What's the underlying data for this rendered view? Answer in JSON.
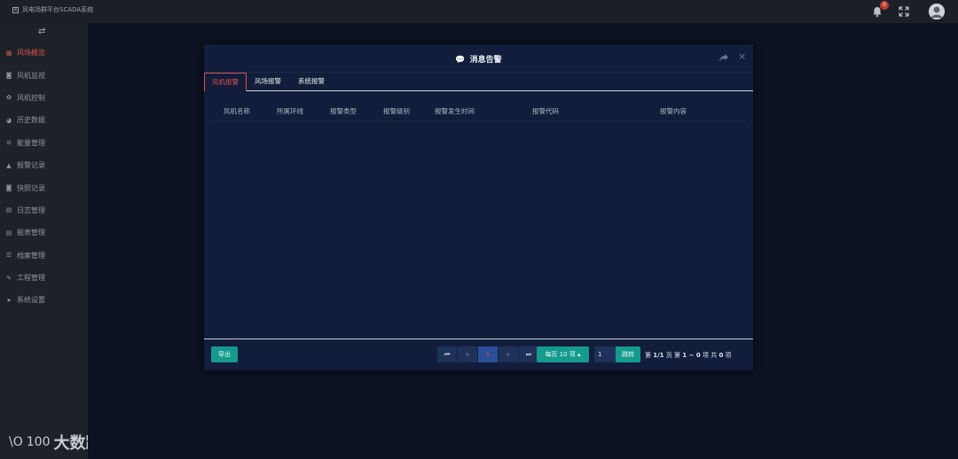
{
  "app": {
    "title": "风电场群平台SCADA系统",
    "logo_glyph": "✕",
    "notification_count": "0",
    "bell_icon": "bell-icon",
    "fullscreen_icon": "fullscreen-icon",
    "avatar_icon": "user-avatar"
  },
  "sidebar": {
    "toggle_glyph": "⇄",
    "items": [
      {
        "label": "风场概览",
        "icon": "grid-icon",
        "glyph": "▦",
        "active": true
      },
      {
        "label": "风机监视",
        "icon": "camera-icon",
        "glyph": "◙"
      },
      {
        "label": "风机控制",
        "icon": "gear-icon",
        "glyph": "✿"
      },
      {
        "label": "历史数据",
        "icon": "pie-chart-icon",
        "glyph": "◕"
      },
      {
        "label": "能量管理",
        "icon": "no-icon",
        "glyph": "⊘"
      },
      {
        "label": "报警记录",
        "icon": "bell-icon",
        "glyph": "▲"
      },
      {
        "label": "快照记录",
        "icon": "camera-icon",
        "glyph": "◙"
      },
      {
        "label": "日志管理",
        "icon": "file-icon",
        "glyph": "▤"
      },
      {
        "label": "报表管理",
        "icon": "table-icon",
        "glyph": "▤"
      },
      {
        "label": "档案管理",
        "icon": "list-icon",
        "glyph": "☰"
      },
      {
        "label": "工程管理",
        "icon": "wrench-icon",
        "glyph": "✎"
      },
      {
        "label": "系统设置",
        "icon": "send-icon",
        "glyph": "➤"
      }
    ]
  },
  "brand": {
    "mark": "\\O",
    "mark2": "100",
    "text": "大数跨境"
  },
  "modal": {
    "title_glyph": "💬",
    "title": "消息告警",
    "close_glyph": "×",
    "tabs": [
      {
        "label": "风机报警",
        "active": true
      },
      {
        "label": "风场报警"
      },
      {
        "label": "系统报警"
      }
    ],
    "columns": [
      "风机名称",
      "所属环线",
      "报警类型",
      "报警级别",
      "报警发生时间",
      "报警代码",
      "报警内容"
    ],
    "rows": [],
    "export_label": "导出",
    "pager": {
      "first": "⏮",
      "prev": "«",
      "current": "1",
      "next": "»",
      "last": "⏭",
      "per_page": "每页 10 项 ▴",
      "goto_value": "1",
      "goto_label": "跳转",
      "info_page_prefix": "第",
      "info_page": "1/1",
      "info_page_suffix": "页 第",
      "info_range": "1 ~ 0",
      "info_range_suffix": "项 共",
      "info_total": "0",
      "info_total_suffix": "项"
    }
  }
}
